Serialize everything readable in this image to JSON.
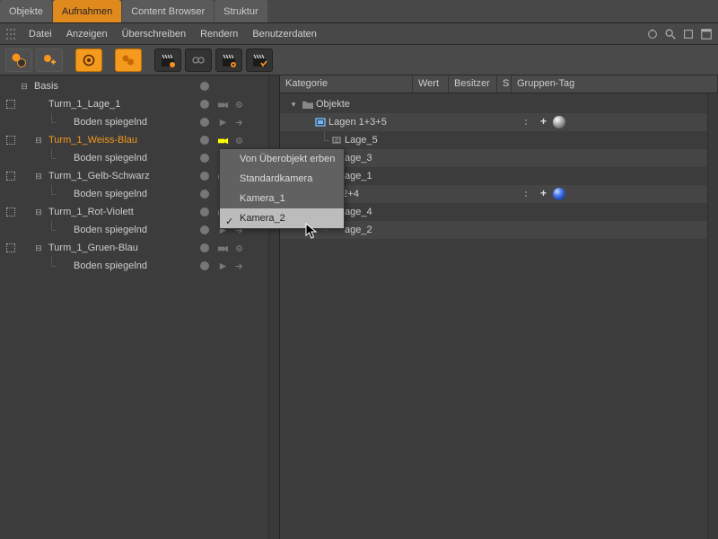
{
  "tabs": [
    "Objekte",
    "Aufnahmen",
    "Content Browser",
    "Struktur"
  ],
  "active_tab": 1,
  "menu": [
    "Datei",
    "Anzeigen",
    "Überschreiben",
    "Rendern",
    "Benutzerdaten"
  ],
  "left_tree": [
    {
      "label": "Basis",
      "indent": 0,
      "expand": "-",
      "selected": false,
      "gutter": false,
      "dot": true,
      "icons": "none"
    },
    {
      "label": "Turm_1_Lage_1",
      "indent": 1,
      "expand": "",
      "selected": false,
      "gutter": true,
      "dot": true,
      "icons": "cam"
    },
    {
      "label": "Boden spiegelnd",
      "indent": 2,
      "expand": "",
      "selected": false,
      "gutter": false,
      "dot": true,
      "icons": "spot",
      "pipe": true
    },
    {
      "label": "Turm_1_Weiss-Blau",
      "indent": 1,
      "expand": "-",
      "selected": true,
      "gutter": true,
      "dot": true,
      "icons": "cam-hl"
    },
    {
      "label": "Boden spiegelnd",
      "indent": 2,
      "expand": "",
      "selected": false,
      "gutter": false,
      "dot": true,
      "icons": "spot",
      "pipe": true
    },
    {
      "label": "Turm_1_Gelb-Schwarz",
      "indent": 1,
      "expand": "-",
      "selected": false,
      "gutter": true,
      "dot": true,
      "icons": "cam"
    },
    {
      "label": "Boden spiegelnd",
      "indent": 2,
      "expand": "",
      "selected": false,
      "gutter": false,
      "dot": true,
      "icons": "spot",
      "pipe": true
    },
    {
      "label": "Turm_1_Rot-Violett",
      "indent": 1,
      "expand": "-",
      "selected": false,
      "gutter": true,
      "dot": true,
      "icons": "cam"
    },
    {
      "label": "Boden spiegelnd",
      "indent": 2,
      "expand": "",
      "selected": false,
      "gutter": false,
      "dot": true,
      "icons": "spot",
      "pipe": true
    },
    {
      "label": "Turm_1_Gruen-Blau",
      "indent": 1,
      "expand": "-",
      "selected": false,
      "gutter": true,
      "dot": true,
      "icons": "cam"
    },
    {
      "label": "Boden spiegelnd",
      "indent": 2,
      "expand": "",
      "selected": false,
      "gutter": false,
      "dot": true,
      "icons": "spot",
      "pipe": true
    }
  ],
  "columns": {
    "cat": "Kategorie",
    "wert": "Wert",
    "bes": "Besitzer",
    "s": "S",
    "grp": "Gruppen-Tag"
  },
  "right_tree": [
    {
      "label": "Objekte",
      "indent": 0,
      "icon": "folder",
      "tag": null,
      "alt": false,
      "sdots": false
    },
    {
      "label": "Lagen 1+3+5",
      "indent": 1,
      "icon": "layer",
      "tag": "grey",
      "alt": true,
      "sdots": true
    },
    {
      "label": "Lage_5",
      "indent": 2,
      "icon": "slot",
      "tag": null,
      "alt": false,
      "sdots": false
    },
    {
      "label": "age_3",
      "indent": 2,
      "icon": "",
      "tag": null,
      "alt": true,
      "sdots": false
    },
    {
      "label": "age_1",
      "indent": 2,
      "icon": "",
      "tag": null,
      "alt": false,
      "sdots": false
    },
    {
      "label": "en 2+4",
      "indent": 1,
      "icon": "",
      "tag": "blue",
      "alt": true,
      "sdots": true
    },
    {
      "label": "age_4",
      "indent": 2,
      "icon": "",
      "tag": null,
      "alt": false,
      "sdots": false
    },
    {
      "label": "age_2",
      "indent": 2,
      "icon": "",
      "tag": null,
      "alt": true,
      "sdots": false
    }
  ],
  "context_menu": {
    "items": [
      "Von Überobjekt erben",
      "Standardkamera",
      "Kamera_1",
      "Kamera_2"
    ],
    "checked_index": 3,
    "hover_index": 3
  }
}
